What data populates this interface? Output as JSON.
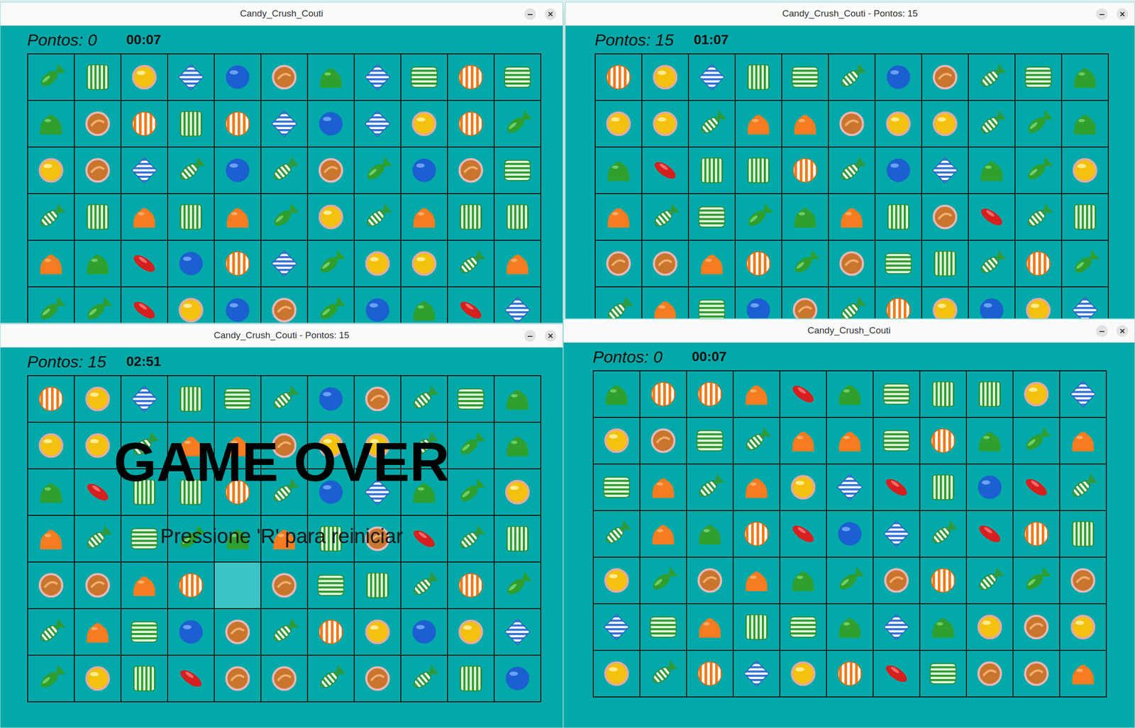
{
  "windows": [
    {
      "title": "Candy_Crush_Couti",
      "score": "Pontos: 0",
      "timer": "00:07",
      "board": [
        [
          "fish",
          "wrapper_v",
          "yellow",
          "blue_diamond",
          "blue",
          "orange",
          "green_drop",
          "blue_diamond",
          "wrapper_h",
          "orange_striped",
          "wrapper_h"
        ],
        [
          "green_drop",
          "orange",
          "orange_striped",
          "wrapper_v",
          "orange_striped",
          "blue_diamond",
          "blue",
          "blue_diamond",
          "yellow",
          "orange_striped",
          "fish"
        ],
        [
          "yellow",
          "orange",
          "blue_diamond",
          "striped_fish",
          "blue",
          "striped_fish",
          "orange",
          "fish",
          "blue",
          "orange",
          "wrapper_h"
        ],
        [
          "striped_fish",
          "wrapper_v",
          "orange_drop",
          "wrapper_v",
          "orange_drop",
          "fish",
          "yellow",
          "striped_fish",
          "orange_drop",
          "wrapper_v",
          "wrapper_v"
        ],
        [
          "orange_drop",
          "green_drop",
          "red_bean",
          "blue",
          "orange_striped",
          "blue_diamond",
          "fish",
          "yellow",
          "yellow",
          "striped_fish",
          "orange_drop"
        ],
        [
          "fish",
          "fish",
          "red_bean",
          "yellow",
          "blue",
          "orange",
          "fish",
          "blue",
          "green_drop",
          "red_bean",
          "blue_diamond"
        ]
      ]
    },
    {
      "title": "Candy_Crush_Couti - Pontos: 15",
      "score": "Pontos: 15",
      "timer": "01:07",
      "board": [
        [
          "orange_striped",
          "yellow",
          "blue_diamond",
          "wrapper_v",
          "wrapper_h",
          "striped_fish",
          "blue",
          "orange",
          "striped_fish",
          "wrapper_h",
          "green_drop"
        ],
        [
          "yellow",
          "yellow",
          "striped_fish",
          "orange_drop",
          "orange_drop",
          "orange",
          "yellow",
          "yellow",
          "striped_fish",
          "fish",
          "green_drop"
        ],
        [
          "green_drop",
          "red_bean",
          "wrapper_v",
          "wrapper_v",
          "orange_striped",
          "striped_fish",
          "blue",
          "blue_diamond",
          "green_drop",
          "fish",
          "yellow"
        ],
        [
          "orange_drop",
          "striped_fish",
          "wrapper_h",
          "fish",
          "green_drop",
          "orange_drop",
          "wrapper_v",
          "orange",
          "red_bean",
          "striped_fish",
          "wrapper_v"
        ],
        [
          "orange",
          "orange",
          "orange_drop",
          "orange_striped",
          "fish",
          "orange",
          "wrapper_h",
          "wrapper_v",
          "striped_fish",
          "orange_striped",
          "fish"
        ],
        [
          "striped_fish",
          "orange_drop",
          "wrapper_h",
          "blue",
          "orange",
          "striped_fish",
          "orange_striped",
          "yellow",
          "blue",
          "yellow",
          "blue_diamond"
        ]
      ]
    },
    {
      "title": "Candy_Crush_Couti - Pontos: 15",
      "score": "Pontos: 15",
      "timer": "02:51",
      "board": [
        [
          "orange_striped",
          "yellow",
          "blue_diamond",
          "wrapper_v",
          "wrapper_h",
          "striped_fish",
          "blue",
          "orange",
          "striped_fish",
          "wrapper_h",
          "green_drop"
        ],
        [
          "yellow",
          "yellow",
          "striped_fish",
          "orange_drop",
          "orange_drop",
          "orange",
          "yellow",
          "yellow",
          "striped_fish",
          "fish",
          "green_drop"
        ],
        [
          "green_drop",
          "red_bean",
          "wrapper_v",
          "wrapper_v",
          "orange_striped",
          "striped_fish",
          "blue",
          "blue_diamond",
          "green_drop",
          "fish",
          "yellow"
        ],
        [
          "orange_drop",
          "striped_fish",
          "wrapper_h",
          "fish",
          "green_drop",
          "orange_drop",
          "wrapper_v",
          "orange",
          "red_bean",
          "striped_fish",
          "wrapper_v"
        ],
        [
          "orange",
          "orange",
          "orange_drop",
          "orange_striped",
          "empty",
          "orange",
          "wrapper_h",
          "wrapper_v",
          "striped_fish",
          "orange_striped",
          "fish"
        ],
        [
          "striped_fish",
          "orange_drop",
          "wrapper_h",
          "blue",
          "orange",
          "striped_fish",
          "orange_striped",
          "yellow",
          "blue",
          "yellow",
          "blue_diamond"
        ],
        [
          "fish",
          "yellow",
          "wrapper_v",
          "red_bean",
          "orange",
          "orange",
          "striped_fish",
          "orange",
          "striped_fish",
          "wrapper_v",
          "blue"
        ]
      ],
      "overlay": {
        "title": "GAME OVER",
        "hint": "Pressione 'R' para reiniciar"
      }
    },
    {
      "title": "Candy_Crush_Couti",
      "score": "Pontos: 0",
      "timer": "00:07",
      "board": [
        [
          "green_drop",
          "orange_striped",
          "orange_striped",
          "orange_drop",
          "red_bean",
          "green_drop",
          "wrapper_h",
          "wrapper_v",
          "wrapper_v",
          "yellow",
          "blue_diamond"
        ],
        [
          "yellow",
          "orange",
          "wrapper_h",
          "striped_fish",
          "orange_drop",
          "orange_drop",
          "wrapper_h",
          "orange_striped",
          "green_drop",
          "fish",
          "orange_drop"
        ],
        [
          "wrapper_h",
          "orange_drop",
          "striped_fish",
          "orange_drop",
          "yellow",
          "blue_diamond",
          "red_bean",
          "wrapper_v",
          "blue",
          "red_bean",
          "striped_fish"
        ],
        [
          "striped_fish",
          "orange_drop",
          "green_drop",
          "orange_striped",
          "red_bean",
          "blue",
          "blue_diamond",
          "striped_fish",
          "red_bean",
          "orange_striped",
          "wrapper_v"
        ],
        [
          "yellow",
          "fish",
          "orange",
          "orange_drop",
          "green_drop",
          "fish",
          "orange",
          "orange_striped",
          "striped_fish",
          "fish",
          "orange"
        ],
        [
          "blue_diamond",
          "wrapper_h",
          "orange_drop",
          "wrapper_v",
          "wrapper_h",
          "green_drop",
          "blue_diamond",
          "green_drop",
          "yellow",
          "orange",
          "yellow"
        ],
        [
          "yellow",
          "striped_fish",
          "orange_striped",
          "blue_diamond",
          "yellow",
          "orange_striped",
          "red_bean",
          "wrapper_h",
          "orange",
          "orange",
          "orange_drop"
        ]
      ]
    }
  ]
}
